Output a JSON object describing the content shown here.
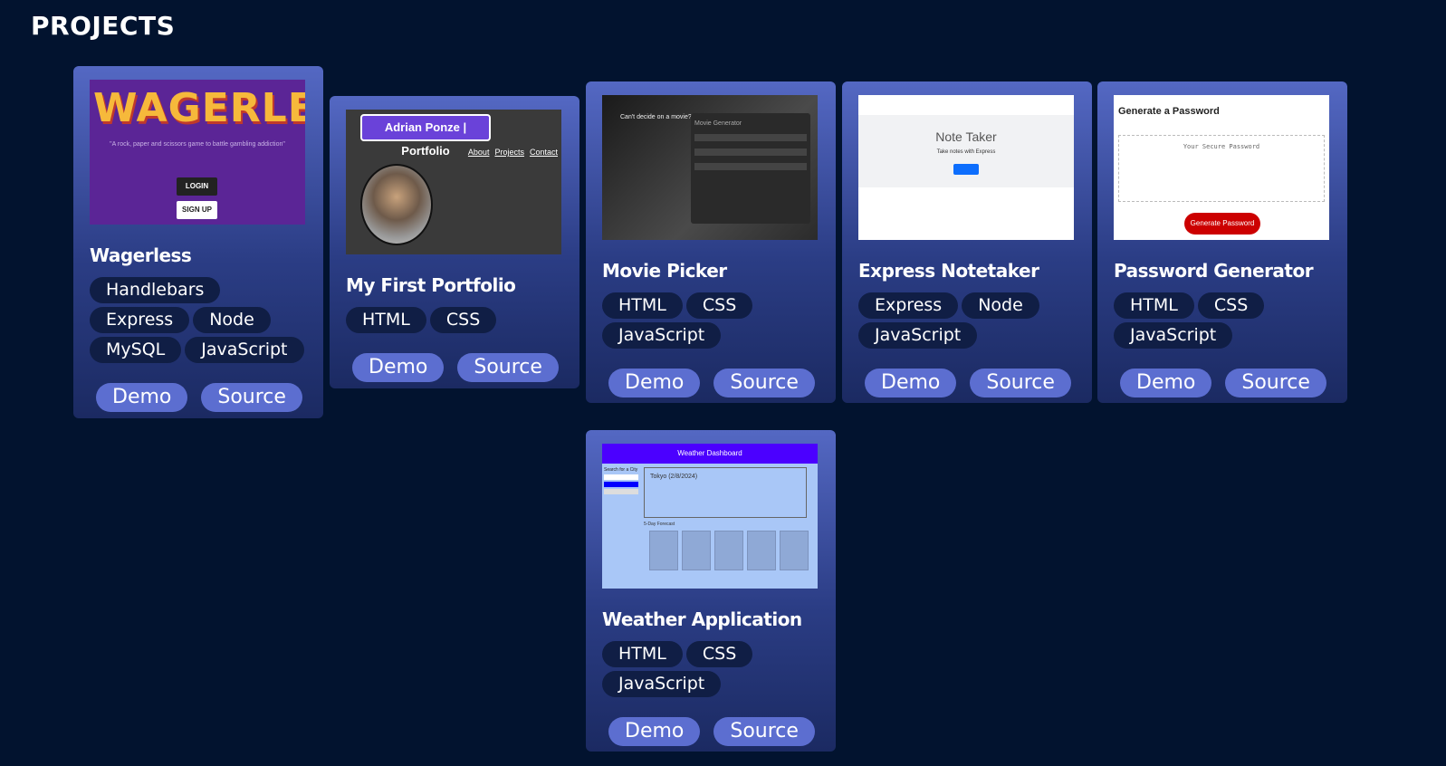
{
  "section": {
    "title": "PROJECTS"
  },
  "projects": [
    {
      "title": "Wagerless",
      "tags": [
        "Handlebars",
        "Express",
        "Node",
        "MySQL",
        "JavaScript"
      ],
      "demo": "Demo",
      "source": "Source",
      "thumb": {
        "logo": "WAGERLESS",
        "subtitle": "\"A rock, paper and scissors game to battle gambling addiction\"",
        "login": "LOGIN",
        "signup": "SIGN UP"
      }
    },
    {
      "title": "My First Portfolio",
      "tags": [
        "HTML",
        "CSS"
      ],
      "demo": "Demo",
      "source": "Source",
      "thumb": {
        "header": "Adrian Ponze | Portfolio",
        "nav": [
          "About",
          "Projects",
          "Contact"
        ]
      }
    },
    {
      "title": "Movie Picker",
      "tags": [
        "HTML",
        "CSS",
        "JavaScript"
      ],
      "demo": "Demo",
      "source": "Source",
      "thumb": {
        "heading": "Can't decide on a movie?",
        "panel": "Movie Generator"
      }
    },
    {
      "title": "Express Notetaker",
      "tags": [
        "Express",
        "Node",
        "JavaScript"
      ],
      "demo": "Demo",
      "source": "Source",
      "thumb": {
        "heading": "Note Taker",
        "subtitle": "Take notes with Express"
      }
    },
    {
      "title": "Password Generator",
      "tags": [
        "HTML",
        "CSS",
        "JavaScript"
      ],
      "demo": "Demo",
      "source": "Source",
      "thumb": {
        "heading": "Generate a Password",
        "placeholder": "Your Secure Password",
        "button": "Generate Password"
      }
    },
    {
      "title": "Weather Application",
      "tags": [
        "HTML",
        "CSS",
        "JavaScript"
      ],
      "demo": "Demo",
      "source": "Source",
      "thumb": {
        "header": "Weather Dashboard",
        "search": "Search for a City",
        "city": "Tokyo (2/8/2024)",
        "forecast": "5-Day Forecast"
      }
    }
  ]
}
